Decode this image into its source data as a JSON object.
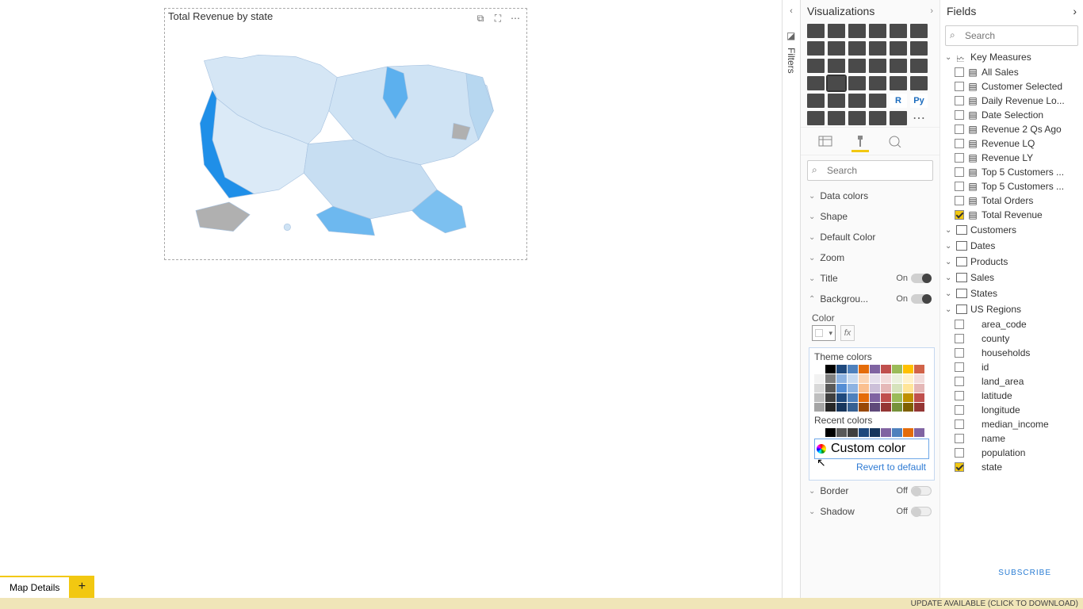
{
  "visual": {
    "title": "Total Revenue by state"
  },
  "filters_tab": {
    "label": "Filters"
  },
  "viz_pane": {
    "title": "Visualizations",
    "search_placeholder": "Search",
    "sections": {
      "data_colors": "Data colors",
      "shape": "Shape",
      "default_color": "Default Color",
      "zoom": "Zoom",
      "title": "Title",
      "title_state": "On",
      "background": "Backgrou...",
      "background_state": "On",
      "color_label": "Color",
      "border": "Border",
      "border_state": "Off",
      "shadow": "Shadow",
      "shadow_state": "Off"
    },
    "palette": {
      "theme_label": "Theme colors",
      "recent_label": "Recent colors",
      "custom_label": "Custom color",
      "revert_label": "Revert to default",
      "main_row": [
        "#ffffff",
        "#000000",
        "#1f497d",
        "#4f81bd",
        "#e46c0a",
        "#8064a2",
        "#c0504d",
        "#9bbb59",
        "#ffc000",
        "#d16349"
      ],
      "tints": [
        [
          "#f2f2f2",
          "#7f7f7f",
          "#8db3e2",
          "#c6d9f0",
          "#fbd5b5",
          "#e5dfec",
          "#f2dcdb",
          "#ebf1dd",
          "#fff2cc",
          "#f2dcdb"
        ],
        [
          "#d9d9d9",
          "#595959",
          "#548dd4",
          "#8db3e2",
          "#fac090",
          "#ccc0d9",
          "#e5b8b7",
          "#d6e3bc",
          "#ffe599",
          "#e5b8b7"
        ],
        [
          "#bfbfbf",
          "#3f3f3f",
          "#1f497d",
          "#4f81bd",
          "#e46c0a",
          "#8064a2",
          "#c0504d",
          "#9bbb59",
          "#bf9000",
          "#c0504d"
        ],
        [
          "#a5a5a5",
          "#262626",
          "#17365d",
          "#366092",
          "#984806",
          "#5f497a",
          "#943634",
          "#76923c",
          "#7f6000",
          "#943634"
        ]
      ],
      "recent": [
        "#ffffff",
        "#000000",
        "#595959",
        "#3f3f3f",
        "#1f497d",
        "#17365d",
        "#8064a2",
        "#4f81bd",
        "#e46c0a",
        "#8064a2"
      ]
    }
  },
  "fields_pane": {
    "title": "Fields",
    "search_placeholder": "Search",
    "tables": [
      {
        "name": "Key Measures",
        "expanded": true,
        "icon": "measure",
        "fields": [
          {
            "label": "All Sales",
            "type": "measure",
            "checked": false
          },
          {
            "label": "Customer Selected",
            "type": "measure",
            "checked": false
          },
          {
            "label": "Daily Revenue Lo...",
            "type": "measure",
            "checked": false
          },
          {
            "label": "Date Selection",
            "type": "measure",
            "checked": false
          },
          {
            "label": "Revenue 2 Qs Ago",
            "type": "measure",
            "checked": false
          },
          {
            "label": "Revenue LQ",
            "type": "measure",
            "checked": false
          },
          {
            "label": "Revenue LY",
            "type": "measure",
            "checked": false
          },
          {
            "label": "Top 5 Customers ...",
            "type": "measure",
            "checked": false
          },
          {
            "label": "Top 5 Customers ...",
            "type": "measure",
            "checked": false
          },
          {
            "label": "Total Orders",
            "type": "measure",
            "checked": false
          },
          {
            "label": "Total Revenue",
            "type": "measure",
            "checked": true
          }
        ]
      },
      {
        "name": "Customers",
        "expanded": false,
        "icon": "table"
      },
      {
        "name": "Dates",
        "expanded": false,
        "icon": "table"
      },
      {
        "name": "Products",
        "expanded": false,
        "icon": "table"
      },
      {
        "name": "Sales",
        "expanded": false,
        "icon": "table"
      },
      {
        "name": "States",
        "expanded": false,
        "icon": "table"
      },
      {
        "name": "US Regions",
        "expanded": true,
        "icon": "table",
        "fields": [
          {
            "label": "area_code",
            "type": "col",
            "checked": false
          },
          {
            "label": "county",
            "type": "col",
            "checked": false
          },
          {
            "label": "households",
            "type": "col",
            "checked": false
          },
          {
            "label": "id",
            "type": "col",
            "checked": false
          },
          {
            "label": "land_area",
            "type": "col",
            "checked": false
          },
          {
            "label": "latitude",
            "type": "col",
            "checked": false
          },
          {
            "label": "longitude",
            "type": "col",
            "checked": false
          },
          {
            "label": "median_income",
            "type": "col",
            "checked": false
          },
          {
            "label": "name",
            "type": "col",
            "checked": false
          },
          {
            "label": "population",
            "type": "col",
            "checked": false
          },
          {
            "label": "state",
            "type": "col",
            "checked": true
          }
        ]
      }
    ]
  },
  "page_tab": "Map Details",
  "update_bar": "UPDATE AVAILABLE (CLICK TO DOWNLOAD)",
  "subscribe": "SUBSCRIBE"
}
